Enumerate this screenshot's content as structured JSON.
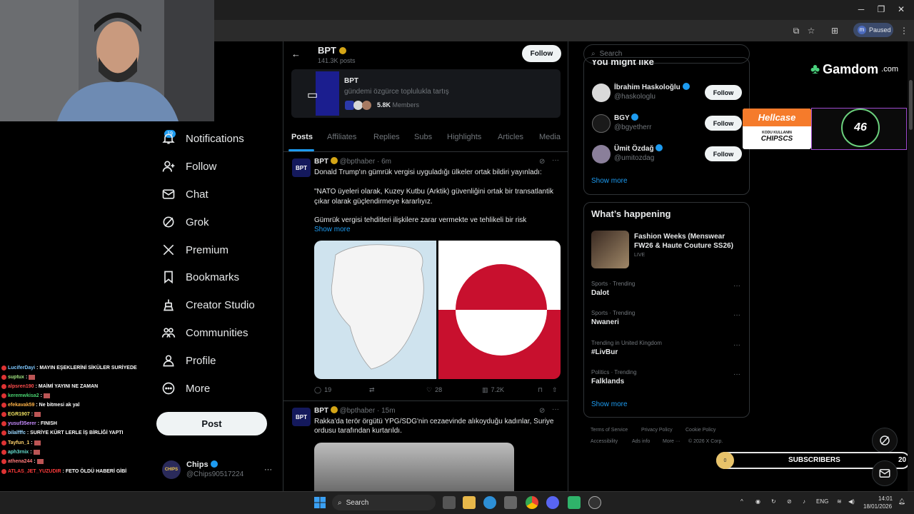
{
  "browser": {
    "paused_label": "Paused",
    "profile_initial": "m",
    "window_controls": [
      "minimize",
      "maximize",
      "close"
    ]
  },
  "nav": {
    "notifications_badge": "19",
    "items": [
      {
        "label": "Notifications",
        "icon": "bell-icon"
      },
      {
        "label": "Follow",
        "icon": "person-plus-icon"
      },
      {
        "label": "Chat",
        "icon": "mail-icon"
      },
      {
        "label": "Grok",
        "icon": "grok-icon"
      },
      {
        "label": "Premium",
        "icon": "x-logo-icon"
      },
      {
        "label": "Bookmarks",
        "icon": "bookmark-icon"
      },
      {
        "label": "Creator Studio",
        "icon": "creator-icon"
      },
      {
        "label": "Communities",
        "icon": "communities-icon"
      },
      {
        "label": "Profile",
        "icon": "profile-icon"
      },
      {
        "label": "More",
        "icon": "more-circle-icon"
      }
    ],
    "post_label": "Post",
    "account": {
      "name": "Chips",
      "handle": "@Chips90517224",
      "avatar_text": "CHIPS"
    }
  },
  "chat": [
    {
      "user": "LuciferDayi",
      "msg": ": MAYIN EŞEKLERİNİ SİKÜLER SURİYEDE",
      "color": "#7ec8ff"
    },
    {
      "user": "suptux",
      "msg": ":",
      "color": "#a0e07f"
    },
    {
      "user": "alpsren190",
      "msg": ": MAİMİ YAYINI NE ZAMAN",
      "color": "#ff4d4d"
    },
    {
      "user": "keremwkisa2",
      "msg": ":",
      "color": "#48d16f"
    },
    {
      "user": "efekavak59",
      "msg": ": Ne bitmesi ak yal",
      "color": "#ffb347"
    },
    {
      "user": "EGR1907",
      "msg": ":",
      "color": "#f5e663"
    },
    {
      "user": "yusuf35erer",
      "msg": ": FINISH",
      "color": "#c78bff"
    },
    {
      "user": "bilalfffc",
      "msg": ": SURİYE KÜRT LERLE İŞ BİRLİĞİ YAPTI",
      "color": "#9ad7ff"
    },
    {
      "user": "Tayfun_1",
      "msg": ":",
      "color": "#ffd36b"
    },
    {
      "user": "aph3rnix",
      "msg": ":",
      "color": "#66e0d1"
    },
    {
      "user": "athena244",
      "msg": ":",
      "color": "#ff7a7a"
    },
    {
      "user": "ATLAS_JET_YUZUDIR",
      "msg": ": FETO ÖLDÜ HABERİ GİBİ",
      "color": "#ff3b3b"
    }
  ],
  "header": {
    "name": "BPT",
    "posts_count": "141.3K posts",
    "follow_label": "Follow"
  },
  "community": {
    "name": "BPT",
    "description": "gündemi özgürce toplulukla tartış",
    "members_count": "5.8K",
    "members_label": "Members"
  },
  "tabs": [
    "Posts",
    "Affiliates",
    "Replies",
    "Subs",
    "Highlights",
    "Articles",
    "Media"
  ],
  "tweets": [
    {
      "name": "BPT",
      "handle": "@bpthaber",
      "time": "· 6m",
      "text1": "Donald Trump'ın gümrük vergisi uyguladığı ülkeler ortak bildiri yayınladı:",
      "text2": "\"NATO üyeleri olarak, Kuzey Kutbu (Arktik) güvenliğini ortak bir transatlantik çıkar olarak güçlendirmeye kararlıyız.",
      "text3": "Gümrük vergisi tehditleri ilişkilere zarar vermekte ve tehlikeli bir risk",
      "show_more": "Show more",
      "replies": "19",
      "likes": "28",
      "views": "7.2K"
    },
    {
      "name": "BPT",
      "handle": "@bpthaber",
      "time": "· 15m",
      "text1": "Rakka'da terör örgütü YPG/SDG'nin cezaevinde alıkoyduğu kadınlar, Suriye",
      "text2": "ordusu tarafından kurtarıldı."
    }
  ],
  "sidebar": {
    "search_placeholder": "Search",
    "suggestions_title": "You might like",
    "suggestions": [
      {
        "name": "İbrahim Haskoloğlu",
        "handle": "@haskologlu",
        "follow": "Follow"
      },
      {
        "name": "BGY",
        "handle": "@bgyetherr",
        "follow": "Follow"
      },
      {
        "name": "Ümit Özdağ",
        "handle": "@umitozdag",
        "follow": "Follow"
      }
    ],
    "show_more": "Show more",
    "happening_title": "What’s happening",
    "event": {
      "title": "Fashion Weeks (Menswear FW26 & Haute Couture SS26)",
      "status": "LIVE"
    },
    "trends": [
      {
        "category": "Sports · Trending",
        "name": "Dalot"
      },
      {
        "category": "Sports · Trending",
        "name": "Nwaneri"
      },
      {
        "category": "Trending in United Kingdom",
        "name": "#LivBur"
      },
      {
        "category": "Politics · Trending",
        "name": "Falklands"
      }
    ],
    "show_more_2": "Show more",
    "footer": [
      "Terms of Service",
      "Privacy Policy",
      "Cookie Policy",
      "Accessibility",
      "Ads info",
      "More ···",
      "© 2026 X Corp."
    ]
  },
  "overlays": {
    "gamdom": "Gamdom",
    "gamdom_suffix": ".com",
    "hellcase": "Hellcase",
    "hellcase_sub": "KODU KULLANIN",
    "hellcase_code": "CHIPSCS",
    "counter": "46",
    "subs_label": "SUBSCRIBERS",
    "subs_current": "0",
    "subs_goal": "20"
  },
  "taskbar": {
    "search_label": "Search",
    "lang": "ENG",
    "time": "14:01",
    "date": "18/01/2026"
  }
}
